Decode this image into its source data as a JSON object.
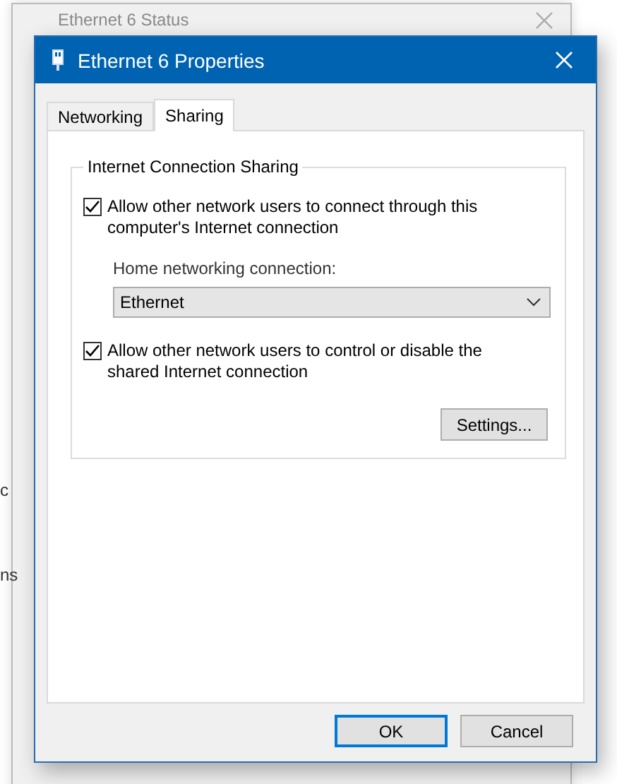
{
  "background_window": {
    "title": "Ethernet 6 Status",
    "fragments": [
      "c",
      "ns"
    ]
  },
  "window": {
    "title": "Ethernet 6 Properties"
  },
  "tabs": [
    {
      "label": "Networking",
      "selected": false
    },
    {
      "label": "Sharing",
      "selected": true
    }
  ],
  "group": {
    "title": "Internet Connection Sharing"
  },
  "options": [
    {
      "kind": "checkbox",
      "label": "Allow other network users to connect through this computer's Internet connection",
      "checked": true
    },
    {
      "kind": "select",
      "label": "Home networking connection:",
      "value": "Ethernet"
    },
    {
      "kind": "checkbox",
      "label": "Allow other network users to control or disable the shared Internet connection",
      "checked": true
    }
  ],
  "settings_button": "Settings...",
  "buttons": [
    {
      "label": "OK",
      "default": true
    },
    {
      "label": "Cancel",
      "default": false
    }
  ]
}
